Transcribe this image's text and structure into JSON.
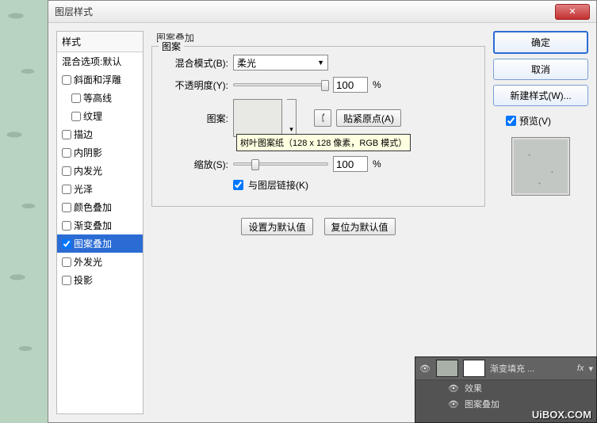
{
  "dialog": {
    "title": "图层样式",
    "style_header": "样式",
    "blend_options": "混合选项:默认",
    "items": [
      {
        "label": "斜面和浮雕",
        "checked": false
      },
      {
        "label": "等高线",
        "checked": false,
        "child": true
      },
      {
        "label": "纹理",
        "checked": false,
        "child": true
      },
      {
        "label": "描边",
        "checked": false
      },
      {
        "label": "内阴影",
        "checked": false
      },
      {
        "label": "内发光",
        "checked": false
      },
      {
        "label": "光泽",
        "checked": false
      },
      {
        "label": "颜色叠加",
        "checked": false
      },
      {
        "label": "渐变叠加",
        "checked": false
      },
      {
        "label": "图案叠加",
        "checked": true,
        "selected": true
      },
      {
        "label": "外发光",
        "checked": false
      },
      {
        "label": "投影",
        "checked": false
      }
    ],
    "section_title": "图案叠加",
    "fieldset_title": "图案",
    "blend_mode_label": "混合模式(B):",
    "blend_mode_value": "柔光",
    "opacity_label": "不透明度(Y):",
    "opacity_value": "100",
    "percent": "%",
    "pattern_label": "图案:",
    "snap_button": "贴紧原点(A)",
    "tooltip": "树叶图案纸（128 x 128 像素，RGB 模式）",
    "scale_label": "缩放(S):",
    "scale_value": "100",
    "link_label": "与图层链接(K)",
    "set_default": "设置为默认值",
    "reset_default": "复位为默认值"
  },
  "right": {
    "ok": "确定",
    "cancel": "取消",
    "new_style": "新建样式(W)...",
    "preview": "预览(V)"
  },
  "layers": {
    "layer_name": "渐变填充 ...",
    "effects": "效果",
    "pattern_overlay": "图案叠加",
    "fx": "fx"
  },
  "watermark": "UiBOX.COM"
}
